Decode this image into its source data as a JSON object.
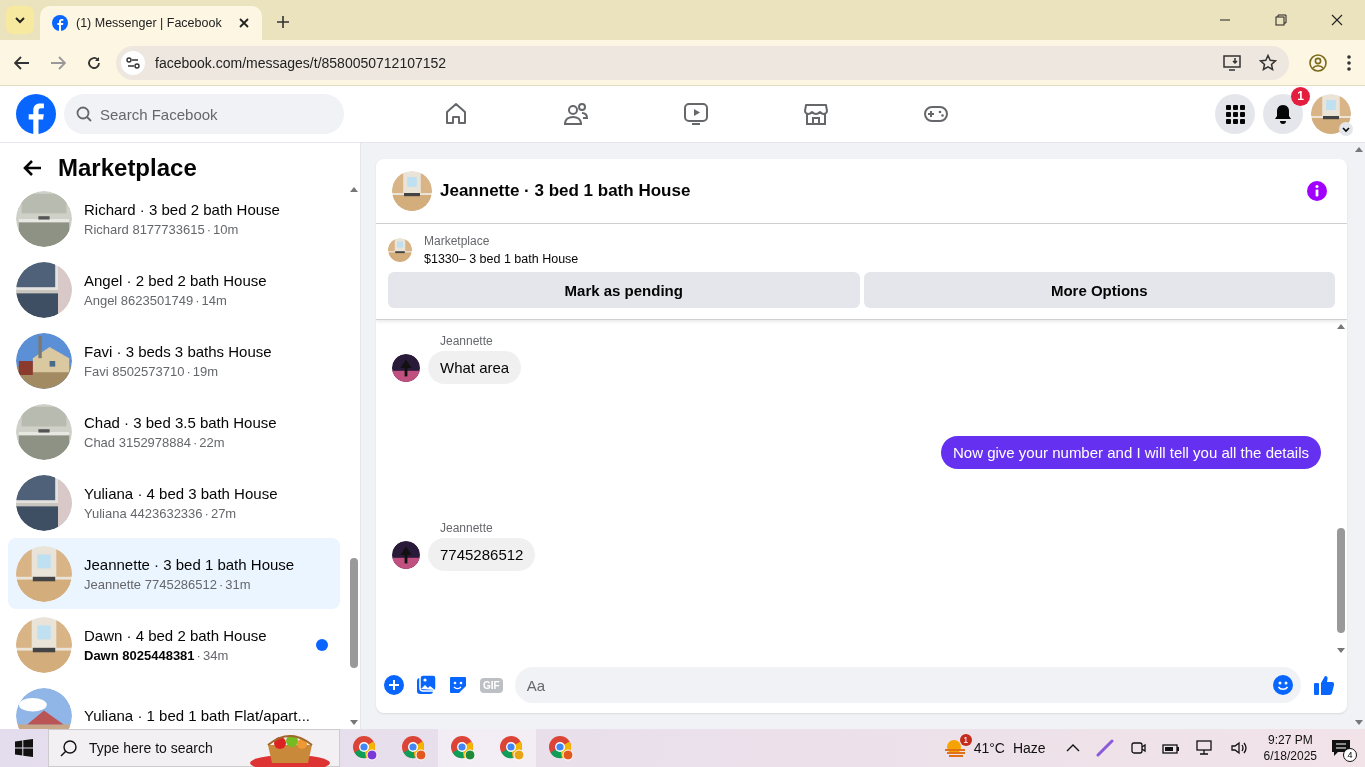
{
  "browser": {
    "tab_title": "(1) Messenger | Facebook",
    "url": "facebook.com/messages/t/8580050712107152"
  },
  "header": {
    "search_placeholder": "Search Facebook",
    "notification_count": "1"
  },
  "sidebar": {
    "title": "Marketplace",
    "conversations": [
      {
        "title": "Richard · 3 bed 2 bath House",
        "preview": "Richard 8177733615",
        "separator": "·",
        "time": "10m",
        "selected": false,
        "unread": false
      },
      {
        "title": "Angel · 2 bed 2 bath House",
        "preview": "Angel 8623501749",
        "separator": "·",
        "time": "14m",
        "selected": false,
        "unread": false
      },
      {
        "title": "Favi · 3 beds 3 baths House",
        "preview": "Favi 8502573710",
        "separator": "·",
        "time": "19m",
        "selected": false,
        "unread": false
      },
      {
        "title": "Chad · 3 bed 3.5 bath House",
        "preview": "Chad 3152978884",
        "separator": "·",
        "time": "22m",
        "selected": false,
        "unread": false
      },
      {
        "title": "Yuliana · 4 bed 3 bath House",
        "preview": "Yuliana 4423632336",
        "separator": "·",
        "time": "27m",
        "selected": false,
        "unread": false
      },
      {
        "title": "Jeannette · 3 bed 1 bath House",
        "preview": "Jeannette 7745286512",
        "separator": "·",
        "time": "31m",
        "selected": true,
        "unread": false
      },
      {
        "title": "Dawn · 4 bed 2 bath House",
        "preview": "Dawn 8025448381",
        "separator": "·",
        "time": "34m",
        "selected": false,
        "unread": true
      },
      {
        "title": "Yuliana · 1 bed 1 bath Flat/apart...",
        "selected": false,
        "unread": false
      }
    ]
  },
  "chat": {
    "title": "Jeannette · 3 bed 1 bath House",
    "listing_label": "Marketplace",
    "listing_title": "$1330– 3 bed 1 bath House",
    "buttons": [
      "Mark as pending",
      "More Options"
    ],
    "messages": [
      {
        "sender": "Jeannette",
        "text": "What area",
        "outgoing": false
      },
      {
        "text": "Now give your number and I will tell you all the details",
        "outgoing": true
      },
      {
        "sender": "Jeannette",
        "text": "7745286512",
        "outgoing": false
      }
    ],
    "gif_label": "GIF",
    "composer_placeholder": "Aa"
  },
  "taskbar": {
    "search_placeholder": "Type here to search",
    "weather_badge": "1",
    "temperature": "41°C",
    "condition": "Haze",
    "time": "9:27 PM",
    "date": "6/18/2025",
    "notification_count": "4"
  }
}
